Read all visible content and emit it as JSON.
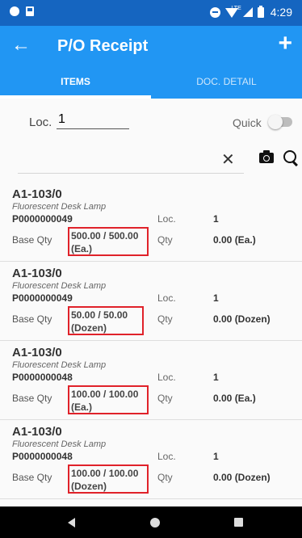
{
  "status_bar": {
    "time": "4:29",
    "network": "LTE"
  },
  "app_bar": {
    "title": "P/O Receipt",
    "back_icon": "arrow-left-icon",
    "add_icon": "plus-icon"
  },
  "tabs": [
    {
      "label": "ITEMS",
      "active": true
    },
    {
      "label": "DOC. DETAIL",
      "active": false
    }
  ],
  "location": {
    "label": "Loc.",
    "value": "1"
  },
  "quick": {
    "label": "Quick",
    "enabled": false
  },
  "search": {
    "value": ""
  },
  "items": [
    {
      "code": "A1-103/0",
      "description": "Fluorescent Desk Lamp",
      "po": "P0000000049",
      "loc_label": "Loc.",
      "loc": "1",
      "base_qty_label": "Base Qty",
      "base_qty": "500.00 / 500.00",
      "base_unit": "(Ea.)",
      "qty_label": "Qty",
      "qty": "0.00 (Ea.)"
    },
    {
      "code": "A1-103/0",
      "description": "Fluorescent Desk Lamp",
      "po": "P0000000049",
      "loc_label": "Loc.",
      "loc": "1",
      "base_qty_label": "Base Qty",
      "base_qty": "50.00 / 50.00",
      "base_unit": "(Dozen)",
      "qty_label": "Qty",
      "qty": "0.00 (Dozen)"
    },
    {
      "code": "A1-103/0",
      "description": "Fluorescent Desk Lamp",
      "po": "P0000000048",
      "loc_label": "Loc.",
      "loc": "1",
      "base_qty_label": "Base Qty",
      "base_qty": "100.00 / 100.00",
      "base_unit": "(Ea.)",
      "qty_label": "Qty",
      "qty": "0.00 (Ea.)"
    },
    {
      "code": "A1-103/0",
      "description": "Fluorescent Desk Lamp",
      "po": "P0000000048",
      "loc_label": "Loc.",
      "loc": "1",
      "base_qty_label": "Base Qty",
      "base_qty": "100.00 / 100.00",
      "base_unit": "(Dozen)",
      "qty_label": "Qty",
      "qty": "0.00 (Dozen)"
    }
  ],
  "colors": {
    "primary": "#2196f3",
    "status_bar": "#1565c0",
    "highlight": "#e0222a"
  }
}
